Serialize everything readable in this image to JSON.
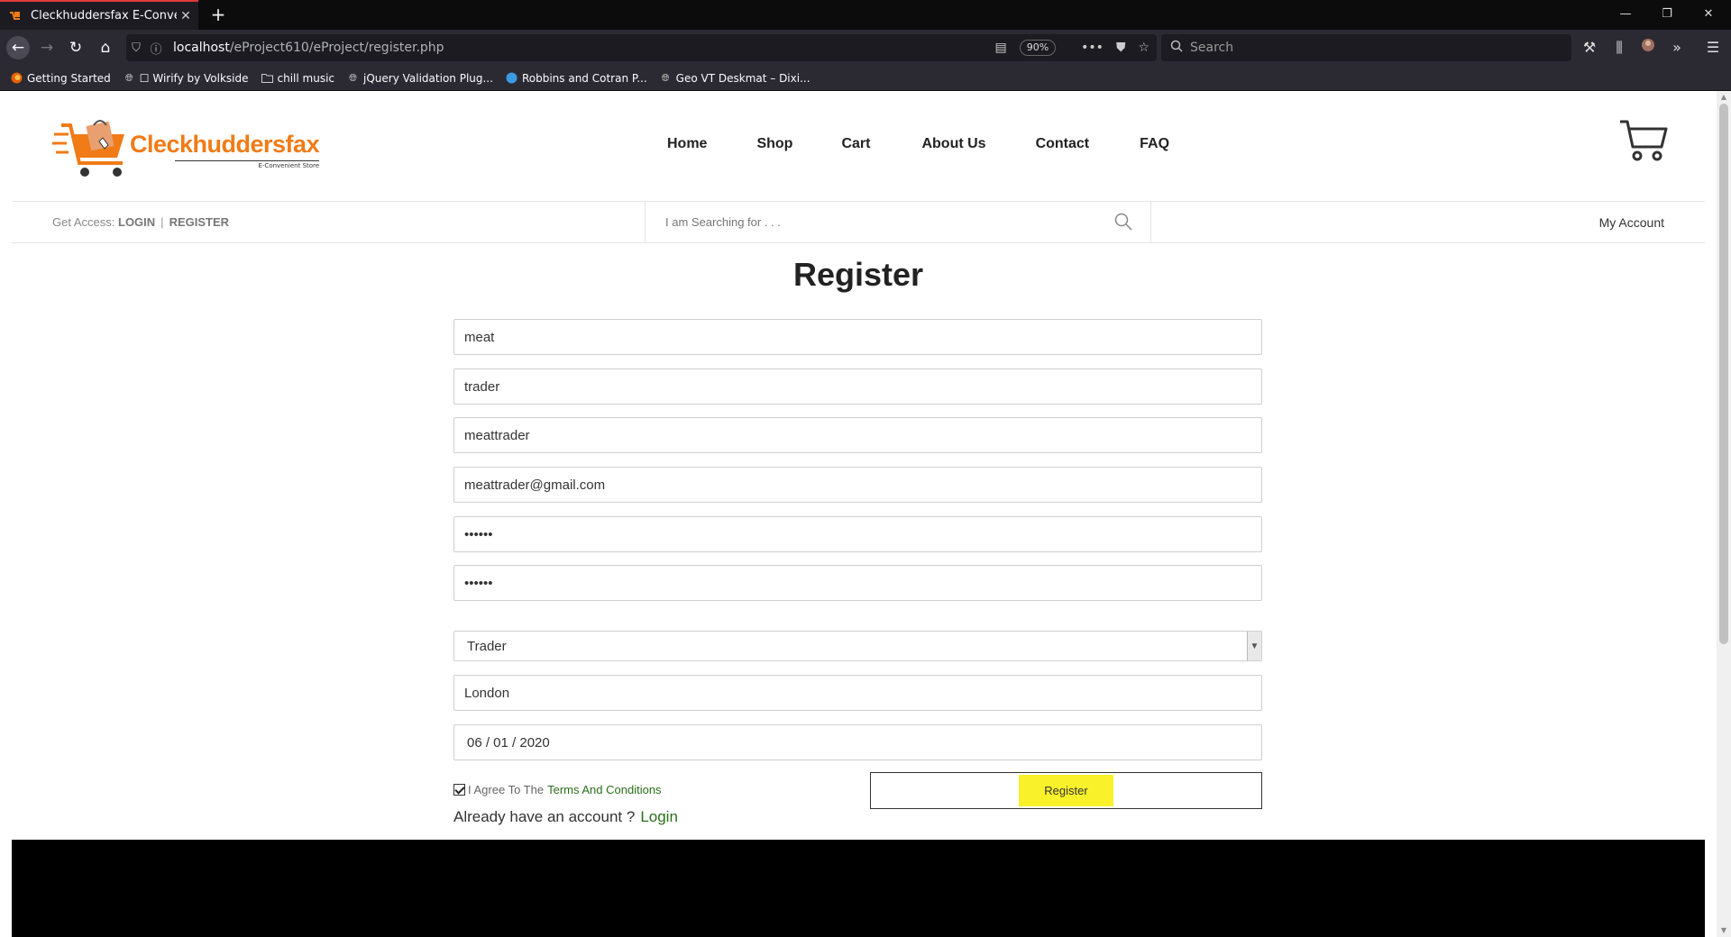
{
  "browser": {
    "tab_title": "Cleckhuddersfax E-Convenient",
    "url_host": "localhost",
    "url_path": "/eProject610/eProject/register.php",
    "zoom": "90%",
    "search_placeholder": "Search",
    "bookmarks": [
      {
        "label": "Getting Started",
        "icon": "firefox-icon"
      },
      {
        "label": "☐ Wirify by Volkside",
        "icon": "globe-icon"
      },
      {
        "label": "chill music",
        "icon": "folder-icon"
      },
      {
        "label": "jQuery Validation Plug...",
        "icon": "globe-icon"
      },
      {
        "label": "Robbins and Cotran P...",
        "icon": "globe-icon"
      },
      {
        "label": "Geo VT Deskmat – Dixi...",
        "icon": "globe-icon"
      }
    ]
  },
  "site": {
    "logo_name": "Cleckhuddersfax",
    "logo_tagline": "E-Convenient Store",
    "nav": [
      "Home",
      "Shop",
      "Cart",
      "About Us",
      "Contact",
      "FAQ"
    ],
    "access_label": "Get Access:",
    "login_label": "LOGIN",
    "register_label": "REGISTER",
    "search_placeholder": "I am Searching for . . .",
    "my_account": "My Account",
    "brand_color": "#f07b17"
  },
  "form": {
    "title": "Register",
    "first_name": "meat",
    "last_name": "trader",
    "username": "meattrader",
    "email": "meattrader@gmail.com",
    "password": "••••••",
    "confirm_password": "••••••",
    "role": "Trader",
    "city": "London",
    "date": "06 / 01 / 2020",
    "agree_text": "I Agree To The",
    "terms_link": "Terms And Conditions",
    "submit_label": "Register",
    "already_text": "Already have an account ?",
    "login_link": "Login"
  }
}
